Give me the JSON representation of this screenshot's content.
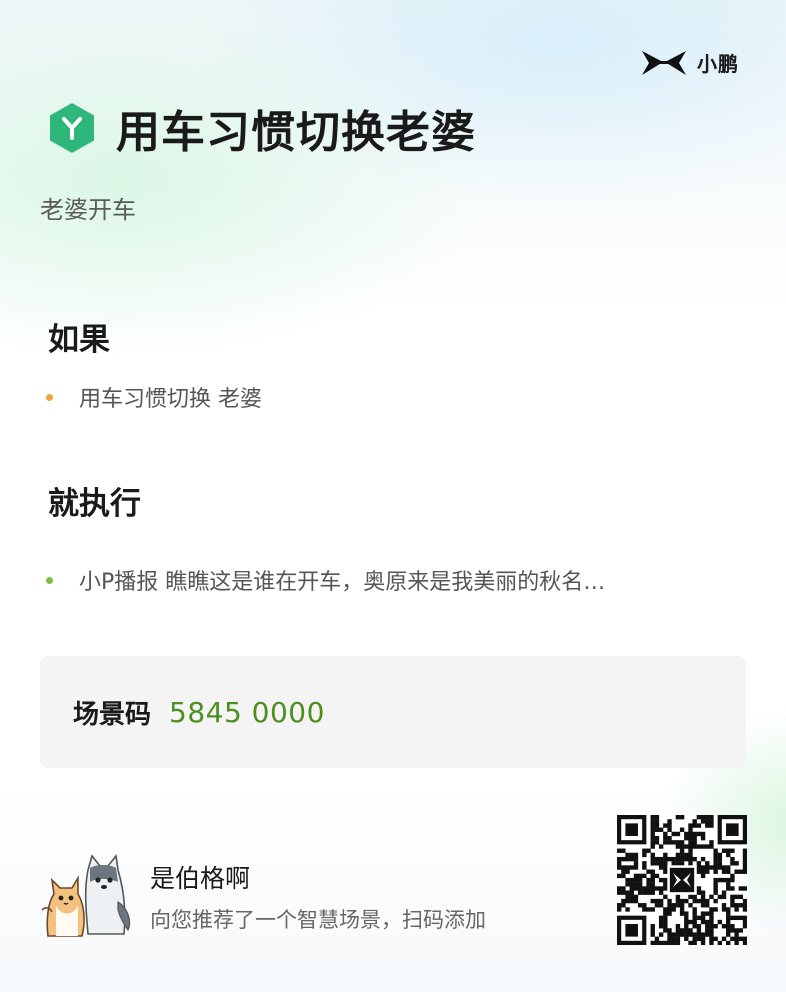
{
  "brand": {
    "name": "小鹏",
    "icon": "xpeng-logo-icon"
  },
  "scene": {
    "icon": "scene-hexagon-icon",
    "icon_color": "#2fb67a",
    "title": "用车习惯切换老婆",
    "subtitle": "老婆开车"
  },
  "condition": {
    "heading": "如果",
    "items": [
      {
        "text": "用车习惯切换 老婆",
        "dot_color": "#f0a33c"
      }
    ]
  },
  "action": {
    "heading": "就执行",
    "items": [
      {
        "text": "小P播报 瞧瞧这是谁在开车，奥原来是我美丽的秋名…",
        "dot_color": "#7dbd44"
      }
    ]
  },
  "scene_code": {
    "label": "场景码",
    "value": "5845 0000",
    "value_color": "#4d8f1f"
  },
  "share": {
    "avatar": "cartoon-cat-and-dog-avatar",
    "author": "是伯格啊",
    "text": "向您推荐了一个智慧场景，扫码添加",
    "qr": "qr-code"
  }
}
